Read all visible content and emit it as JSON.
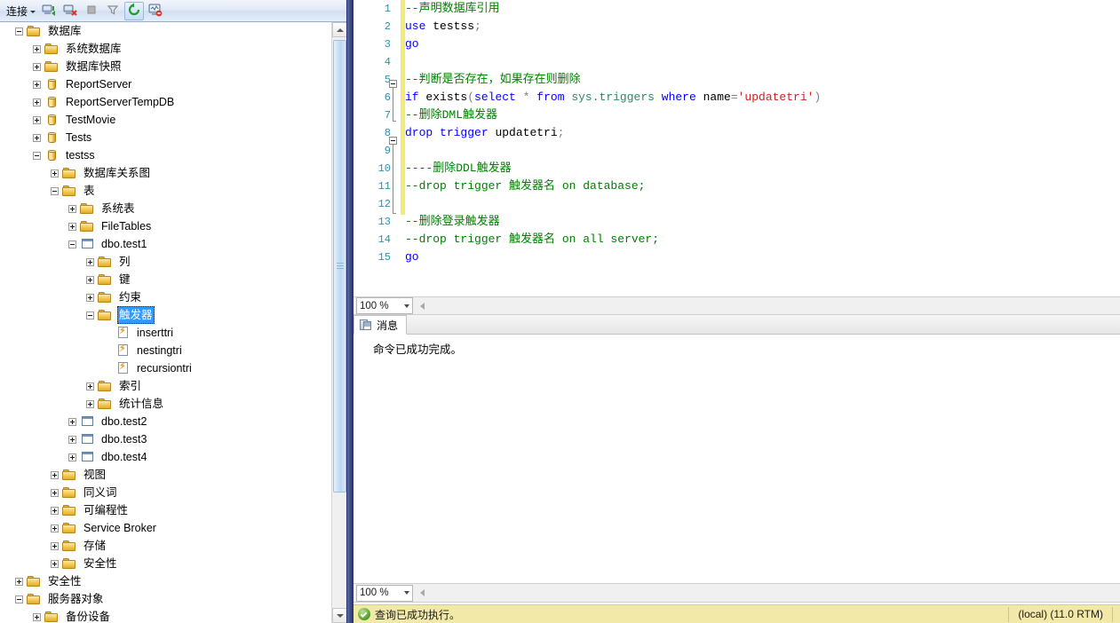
{
  "object_explorer": {
    "toolbar": {
      "connect_label": "连接",
      "buttons": [
        {
          "name": "connect-object-explorer",
          "icon": "connect-icon"
        },
        {
          "name": "disconnect-object-explorer",
          "icon": "disconnect-icon"
        },
        {
          "name": "stop-icon",
          "icon": "stop-icon"
        },
        {
          "name": "filter-icon",
          "icon": "filter-icon"
        },
        {
          "name": "refresh-icon",
          "icon": "refresh-icon"
        },
        {
          "name": "activity-monitor-icon",
          "icon": "activity-monitor-icon"
        }
      ]
    },
    "tree": [
      {
        "label": "数据库",
        "indent": 0,
        "state": "expanded",
        "icon": "folder",
        "selected": false
      },
      {
        "label": "系统数据库",
        "indent": 1,
        "state": "collapsed",
        "icon": "folder",
        "selected": false
      },
      {
        "label": "数据库快照",
        "indent": 1,
        "state": "collapsed",
        "icon": "folder",
        "selected": false
      },
      {
        "label": "ReportServer",
        "indent": 1,
        "state": "collapsed",
        "icon": "database",
        "selected": false
      },
      {
        "label": "ReportServerTempDB",
        "indent": 1,
        "state": "collapsed",
        "icon": "database",
        "selected": false
      },
      {
        "label": "TestMovie",
        "indent": 1,
        "state": "collapsed",
        "icon": "database",
        "selected": false
      },
      {
        "label": "Tests",
        "indent": 1,
        "state": "collapsed",
        "icon": "database",
        "selected": false
      },
      {
        "label": "testss",
        "indent": 1,
        "state": "expanded",
        "icon": "database",
        "selected": false
      },
      {
        "label": "数据库关系图",
        "indent": 2,
        "state": "collapsed",
        "icon": "folder",
        "selected": false
      },
      {
        "label": "表",
        "indent": 2,
        "state": "expanded",
        "icon": "folder",
        "selected": false
      },
      {
        "label": "系统表",
        "indent": 3,
        "state": "collapsed",
        "icon": "folder",
        "selected": false
      },
      {
        "label": "FileTables",
        "indent": 3,
        "state": "collapsed",
        "icon": "folder",
        "selected": false
      },
      {
        "label": "dbo.test1",
        "indent": 3,
        "state": "expanded",
        "icon": "table",
        "selected": false
      },
      {
        "label": "列",
        "indent": 4,
        "state": "collapsed",
        "icon": "folder",
        "selected": false
      },
      {
        "label": "键",
        "indent": 4,
        "state": "collapsed",
        "icon": "folder",
        "selected": false
      },
      {
        "label": "约束",
        "indent": 4,
        "state": "collapsed",
        "icon": "folder",
        "selected": false
      },
      {
        "label": "触发器",
        "indent": 4,
        "state": "expanded",
        "icon": "folder",
        "selected": true
      },
      {
        "label": "inserttri",
        "indent": 5,
        "state": "leaf",
        "icon": "trigger",
        "selected": false
      },
      {
        "label": "nestingtri",
        "indent": 5,
        "state": "leaf",
        "icon": "trigger",
        "selected": false
      },
      {
        "label": "recursiontri",
        "indent": 5,
        "state": "leaf",
        "icon": "trigger",
        "selected": false
      },
      {
        "label": "索引",
        "indent": 4,
        "state": "collapsed",
        "icon": "folder",
        "selected": false
      },
      {
        "label": "统计信息",
        "indent": 4,
        "state": "collapsed",
        "icon": "folder",
        "selected": false
      },
      {
        "label": "dbo.test2",
        "indent": 3,
        "state": "collapsed",
        "icon": "table",
        "selected": false
      },
      {
        "label": "dbo.test3",
        "indent": 3,
        "state": "collapsed",
        "icon": "table",
        "selected": false
      },
      {
        "label": "dbo.test4",
        "indent": 3,
        "state": "collapsed",
        "icon": "table",
        "selected": false
      },
      {
        "label": "视图",
        "indent": 2,
        "state": "collapsed",
        "icon": "folder",
        "selected": false
      },
      {
        "label": "同义词",
        "indent": 2,
        "state": "collapsed",
        "icon": "folder",
        "selected": false
      },
      {
        "label": "可编程性",
        "indent": 2,
        "state": "collapsed",
        "icon": "folder",
        "selected": false
      },
      {
        "label": "Service Broker",
        "indent": 2,
        "state": "collapsed",
        "icon": "folder",
        "selected": false
      },
      {
        "label": "存储",
        "indent": 2,
        "state": "collapsed",
        "icon": "folder",
        "selected": false
      },
      {
        "label": "安全性",
        "indent": 2,
        "state": "collapsed",
        "icon": "folder",
        "selected": false
      },
      {
        "label": "安全性",
        "indent": 0,
        "state": "collapsed",
        "icon": "folder",
        "selected": false
      },
      {
        "label": "服务器对象",
        "indent": 0,
        "state": "expanded",
        "icon": "folder",
        "selected": false
      },
      {
        "label": "备份设备",
        "indent": 1,
        "state": "collapsed",
        "icon": "folder",
        "selected": false
      }
    ]
  },
  "editor": {
    "zoom": "100 %",
    "lines": [
      {
        "n": "1",
        "tokens": [
          {
            "t": "--声明数据库引用",
            "c": "comment"
          }
        ]
      },
      {
        "n": "2",
        "tokens": [
          {
            "t": "use",
            "c": "kw"
          },
          {
            "t": " ",
            "c": "plain"
          },
          {
            "t": "testss",
            "c": "plain"
          },
          {
            "t": ";",
            "c": "op"
          }
        ]
      },
      {
        "n": "3",
        "tokens": [
          {
            "t": "go",
            "c": "kw"
          }
        ]
      },
      {
        "n": "4",
        "tokens": []
      },
      {
        "n": "5",
        "tokens": [
          {
            "t": "--判断是否存在，如果存在则删除",
            "c": "comment"
          }
        ]
      },
      {
        "n": "6",
        "tokens": [
          {
            "t": "if",
            "c": "kw"
          },
          {
            "t": " ",
            "c": "plain"
          },
          {
            "t": "exists",
            "c": "plain"
          },
          {
            "t": "(",
            "c": "op"
          },
          {
            "t": "select",
            "c": "kw"
          },
          {
            "t": " ",
            "c": "plain"
          },
          {
            "t": "*",
            "c": "op"
          },
          {
            "t": " ",
            "c": "plain"
          },
          {
            "t": "from",
            "c": "kw"
          },
          {
            "t": " ",
            "c": "plain"
          },
          {
            "t": "sys.triggers",
            "c": "obj"
          },
          {
            "t": " ",
            "c": "plain"
          },
          {
            "t": "where",
            "c": "kw"
          },
          {
            "t": " ",
            "c": "plain"
          },
          {
            "t": "name",
            "c": "plain"
          },
          {
            "t": "=",
            "c": "op"
          },
          {
            "t": "'updatetri'",
            "c": "str"
          },
          {
            "t": ")",
            "c": "op"
          }
        ]
      },
      {
        "n": "7",
        "tokens": [
          {
            "t": "--删除DML触发器",
            "c": "comment"
          }
        ]
      },
      {
        "n": "8",
        "tokens": [
          {
            "t": "drop",
            "c": "kw"
          },
          {
            "t": " ",
            "c": "plain"
          },
          {
            "t": "trigger",
            "c": "kw"
          },
          {
            "t": " ",
            "c": "plain"
          },
          {
            "t": "updatetri",
            "c": "plain"
          },
          {
            "t": ";",
            "c": "op"
          }
        ]
      },
      {
        "n": "9",
        "tokens": []
      },
      {
        "n": "10",
        "tokens": [
          {
            "t": "----删除DDL触发器",
            "c": "comment"
          }
        ]
      },
      {
        "n": "11",
        "tokens": [
          {
            "t": "--drop trigger 触发器名 on database;",
            "c": "comment"
          }
        ]
      },
      {
        "n": "12",
        "tokens": []
      },
      {
        "n": "13",
        "tokens": [
          {
            "t": "--删除登录触发器",
            "c": "comment"
          }
        ]
      },
      {
        "n": "14",
        "tokens": [
          {
            "t": "--drop trigger 触发器名 on all server;",
            "c": "comment"
          }
        ]
      },
      {
        "n": "15",
        "tokens": [
          {
            "t": "go",
            "c": "kw"
          }
        ]
      }
    ]
  },
  "results": {
    "tab_label": "消息",
    "message": "命令已成功完成。",
    "zoom": "100 %"
  },
  "statusbar": {
    "text": "查询已成功执行。",
    "server": "(local) (11.0 RTM)"
  }
}
